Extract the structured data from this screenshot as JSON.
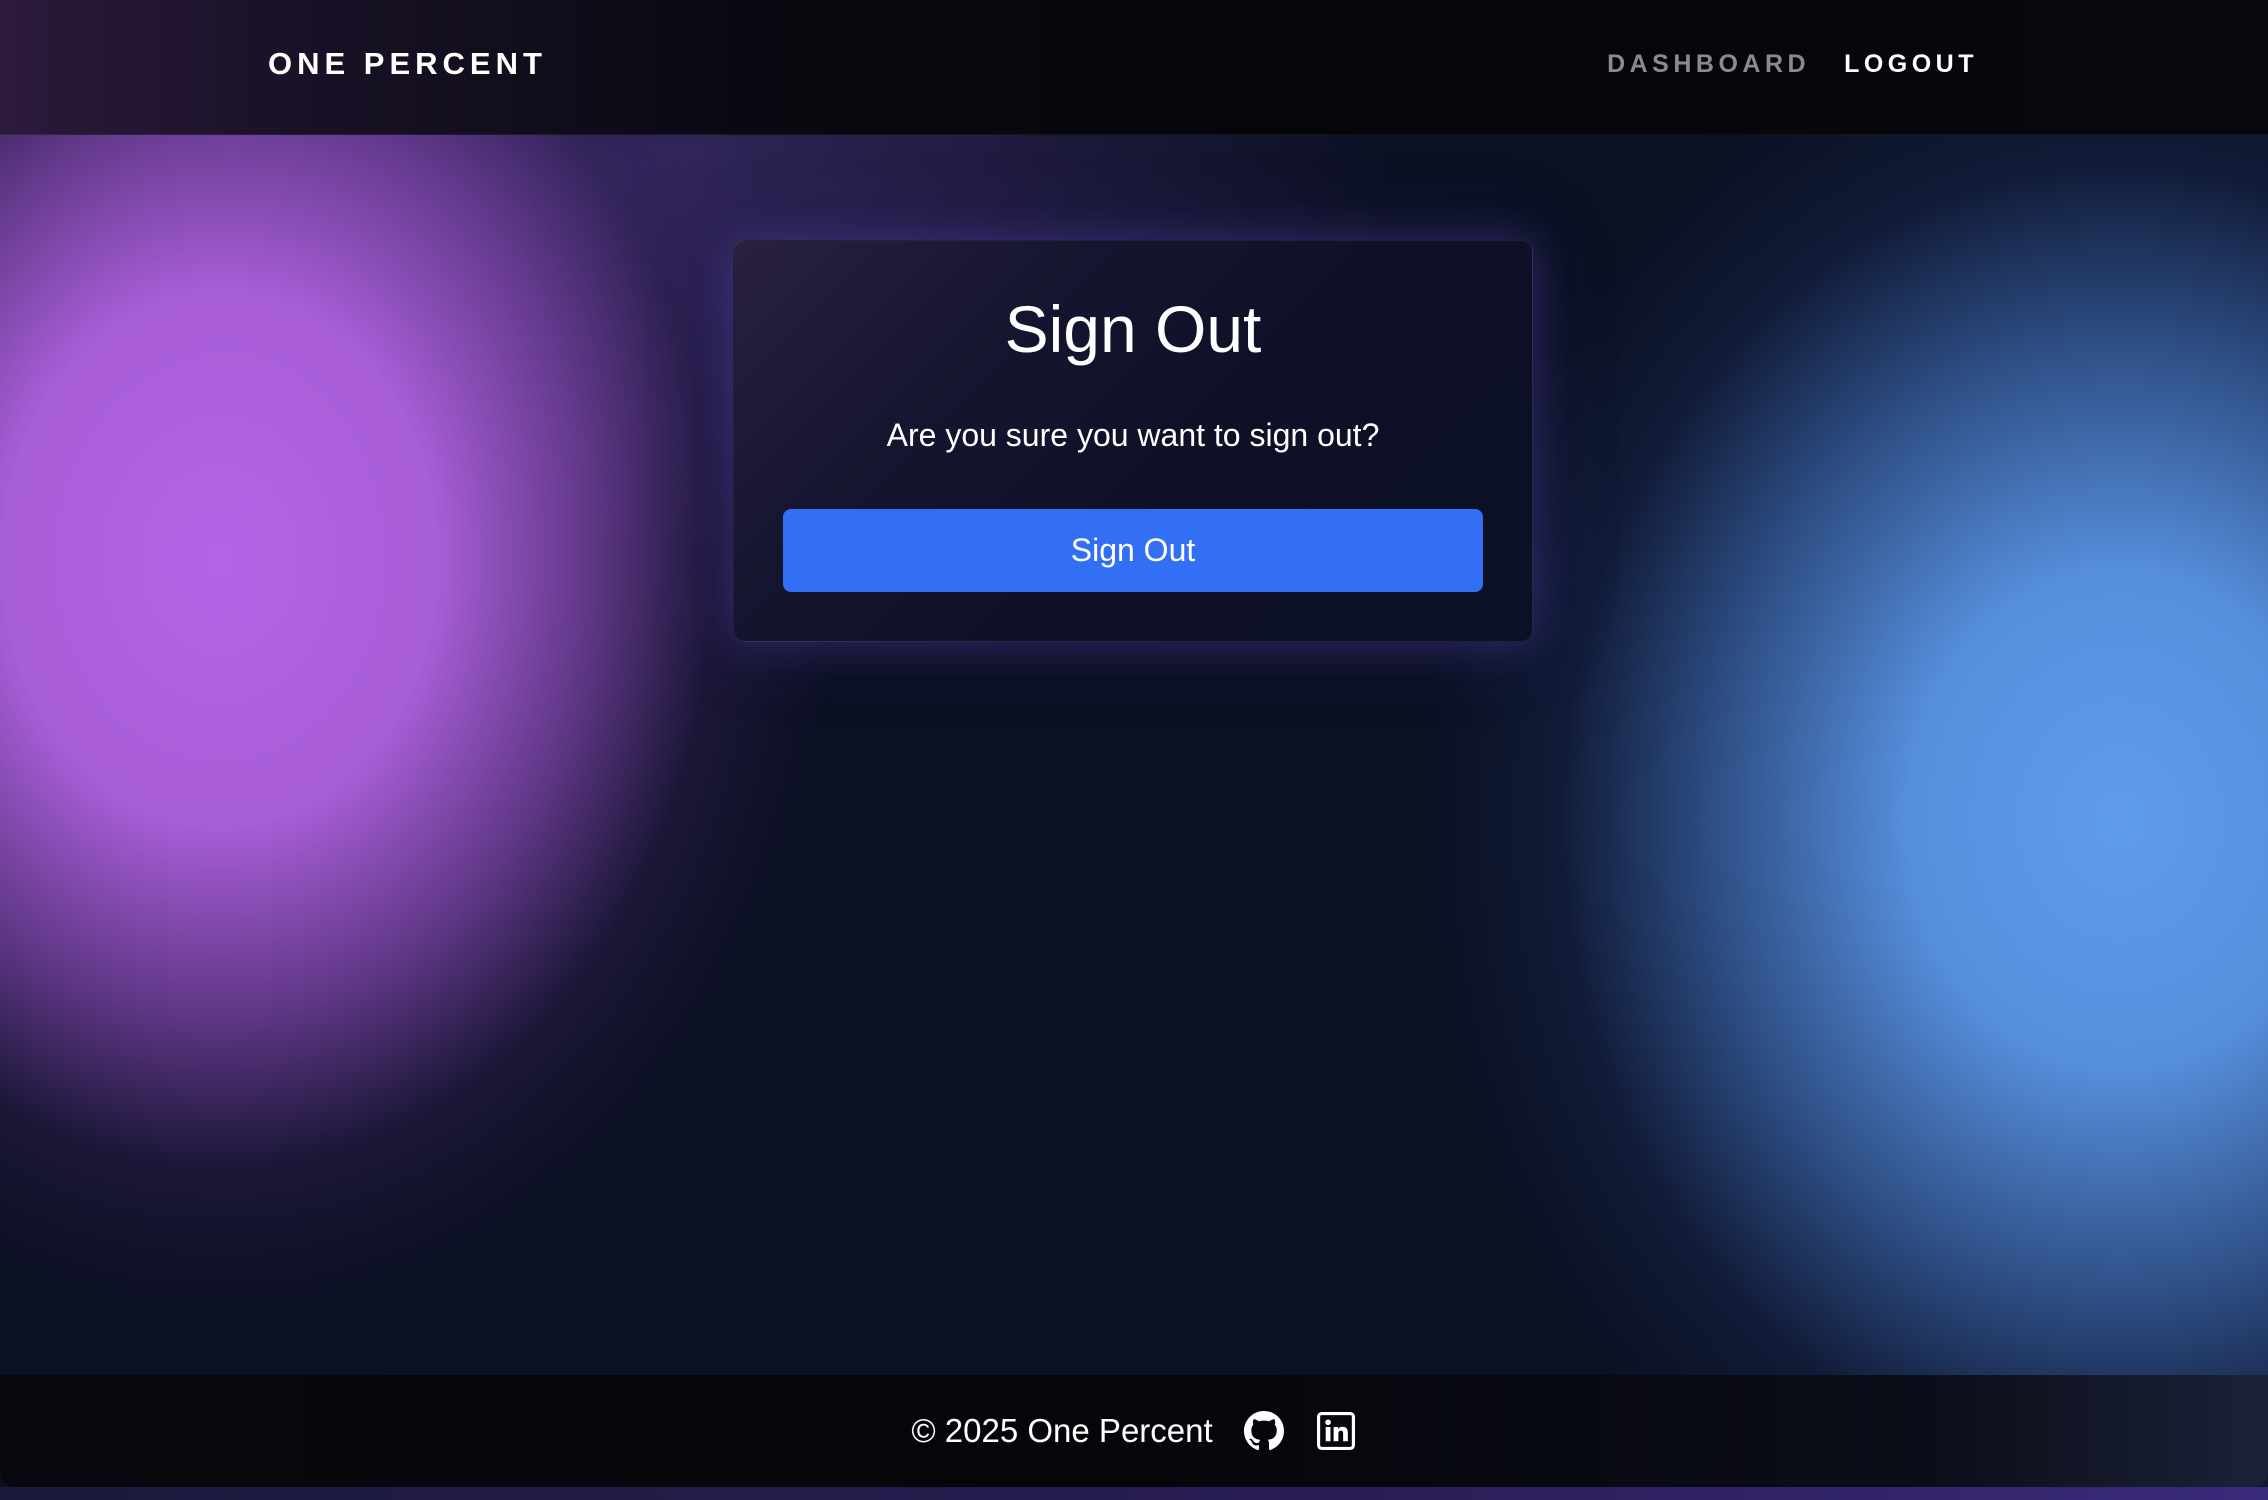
{
  "header": {
    "brand": "ONE PERCENT",
    "nav": {
      "dashboard_label": "DASHBOARD",
      "logout_label": "LOGOUT"
    }
  },
  "card": {
    "title": "Sign Out",
    "message": "Are you sure you want to sign out?",
    "button_label": "Sign Out"
  },
  "footer": {
    "copyright": "© 2025 One Percent",
    "icons": [
      "github-icon",
      "linkedin-icon"
    ]
  },
  "colors": {
    "primary_button": "#336ff4",
    "background": "#0b1022",
    "purple_glow": "#b064e0",
    "blue_glow": "#5f9beb"
  }
}
